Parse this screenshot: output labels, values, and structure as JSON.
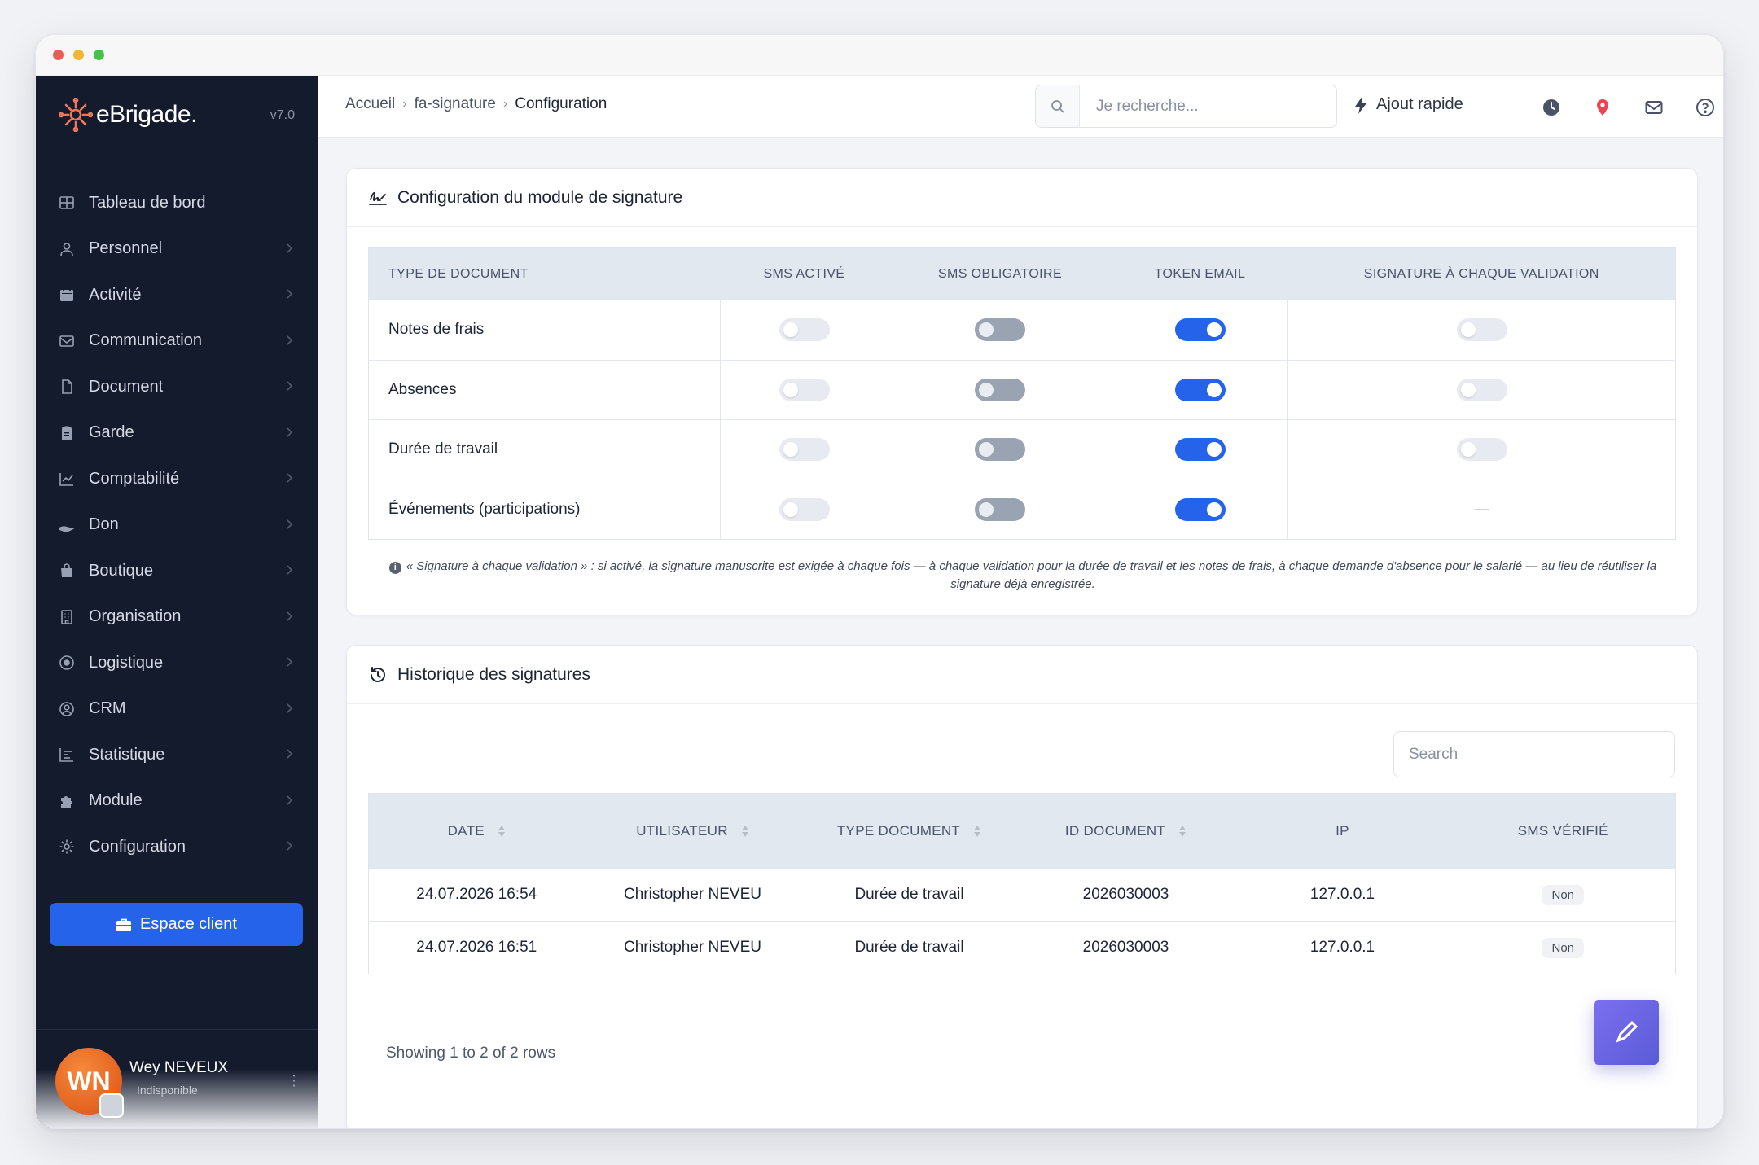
{
  "window": {
    "title": "eBrigade"
  },
  "brand": {
    "name": "eBrigade.",
    "version": "v7.0"
  },
  "sidebar": {
    "items": [
      {
        "label": "Tableau de bord",
        "icon": "grid-icon"
      },
      {
        "label": "Personnel",
        "icon": "user-icon"
      },
      {
        "label": "Activité",
        "icon": "calendar-icon"
      },
      {
        "label": "Communication",
        "icon": "envelope-icon"
      },
      {
        "label": "Document",
        "icon": "file-icon"
      },
      {
        "label": "Garde",
        "icon": "clipboard-icon"
      },
      {
        "label": "Comptabilité",
        "icon": "chart-line-icon"
      },
      {
        "label": "Don",
        "icon": "hand-holding-icon"
      },
      {
        "label": "Boutique",
        "icon": "shopping-bag-icon"
      },
      {
        "label": "Organisation",
        "icon": "building-icon"
      },
      {
        "label": "Logistique",
        "icon": "dot-circle-icon"
      },
      {
        "label": "CRM",
        "icon": "user-circle-icon"
      },
      {
        "label": "Statistique",
        "icon": "chart-bar-icon"
      },
      {
        "label": "Module",
        "icon": "puzzle-icon"
      },
      {
        "label": "Configuration",
        "icon": "cog-icon"
      }
    ],
    "client_button": "Espace client",
    "user": {
      "initials": "WN",
      "name": "Wey NEVEUX",
      "status": "Indisponible"
    }
  },
  "header": {
    "breadcrumb": [
      "Accueil",
      "fa-signature",
      "Configuration"
    ],
    "search_placeholder": "Je recherche...",
    "quick_add": "Ajout rapide"
  },
  "config_card": {
    "title": "Configuration du module de signature",
    "columns": [
      "TYPE DE DOCUMENT",
      "SMS ACTIVÉ",
      "SMS OBLIGATOIRE",
      "TOKEN EMAIL",
      "SIGNATURE À CHAQUE VALIDATION"
    ],
    "rows": [
      {
        "type": "Notes de frais",
        "sms_active": false,
        "sms_obligatoire": false,
        "token_email": true,
        "signature_validation": false
      },
      {
        "type": "Absences",
        "sms_active": false,
        "sms_obligatoire": false,
        "token_email": true,
        "signature_validation": false
      },
      {
        "type": "Durée de travail",
        "sms_active": false,
        "sms_obligatoire": false,
        "token_email": true,
        "signature_validation": false
      },
      {
        "type": "Événements (participations)",
        "sms_active": false,
        "sms_obligatoire": false,
        "token_email": true,
        "signature_validation": "—"
      }
    ],
    "note": "« Signature à chaque validation » : si activé, la signature manuscrite est exigée à chaque fois — à chaque validation pour la durée de travail et les notes de frais, à chaque demande d'absence pour le salarié — au lieu de réutiliser la signature déjà enregistrée."
  },
  "history_card": {
    "title": "Historique des signatures",
    "search_placeholder": "Search",
    "columns": [
      "DATE",
      "UTILISATEUR",
      "TYPE DOCUMENT",
      "ID DOCUMENT",
      "IP",
      "SMS VÉRIFIÉ"
    ],
    "rows": [
      {
        "date": "24.07.2026 16:54",
        "user": "Christopher NEVEU",
        "doc_type": "Durée de travail",
        "doc_id": "2026030003",
        "ip": "127.0.0.1",
        "sms_verified": "Non"
      },
      {
        "date": "24.07.2026 16:51",
        "user": "Christopher NEVEU",
        "doc_type": "Durée de travail",
        "doc_id": "2026030003",
        "ip": "127.0.0.1",
        "sms_verified": "Non"
      }
    ],
    "footer": "Showing 1 to 2 of 2 rows"
  },
  "colors": {
    "accent": "#2563eb",
    "sidebar_bg": "#141b2d",
    "fab": "#6a64e4"
  }
}
